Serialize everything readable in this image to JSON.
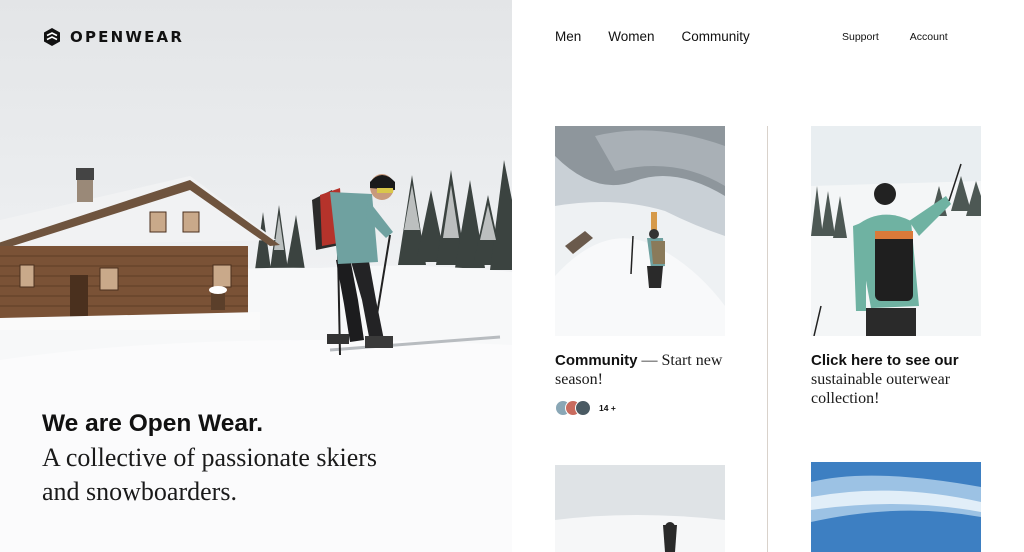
{
  "brand": {
    "name": "OPENWEAR",
    "icon": "openwear-logo-icon"
  },
  "hero": {
    "title": "We are Open Wear.",
    "subtitle_line1": "A collective of passionate skiers",
    "subtitle_line2": "and snowboarders."
  },
  "nav": {
    "main": [
      "Men",
      "Women",
      "Community"
    ],
    "utility": [
      "Support",
      "Account"
    ]
  },
  "cards": [
    {
      "title_bold": "Community",
      "title_rest": " — Start new season!",
      "member_count": "14 +"
    },
    {
      "title_bold": "Click here to see our",
      "title_rest": "sustainable outerwear collection!"
    }
  ],
  "colors": {
    "text": "#111111",
    "divider": "#d9d2cb",
    "jacket": "#6fa1a0",
    "sky_blue": "#3d7fc2"
  }
}
